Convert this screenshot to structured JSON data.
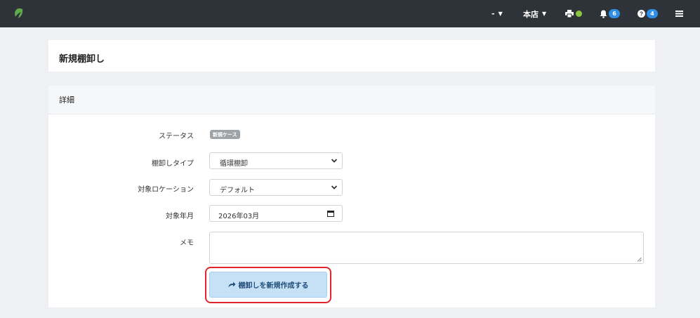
{
  "navbar": {
    "user_label": "-",
    "store_label": "本店",
    "notification_count": "6",
    "help_count": "4"
  },
  "page": {
    "title": "新規棚卸し"
  },
  "details": {
    "section_title": "詳細",
    "status_label": "ステータス",
    "status_value": "新規ケース",
    "type_label": "棚卸しタイプ",
    "type_value": "循環棚卸",
    "location_label": "対象ロケーション",
    "location_value": "デフォルト",
    "month_label": "対象年月",
    "month_value": "2026年03月",
    "memo_label": "メモ",
    "memo_value": "",
    "submit_label": "棚卸しを新規作成する"
  },
  "colors": {
    "navbar_bg": "#2d3338",
    "badge_blue": "#2f8fe6",
    "status_green": "#8cc63f",
    "button_bg": "#c6e1f6",
    "highlight_red": "#e0262b"
  }
}
